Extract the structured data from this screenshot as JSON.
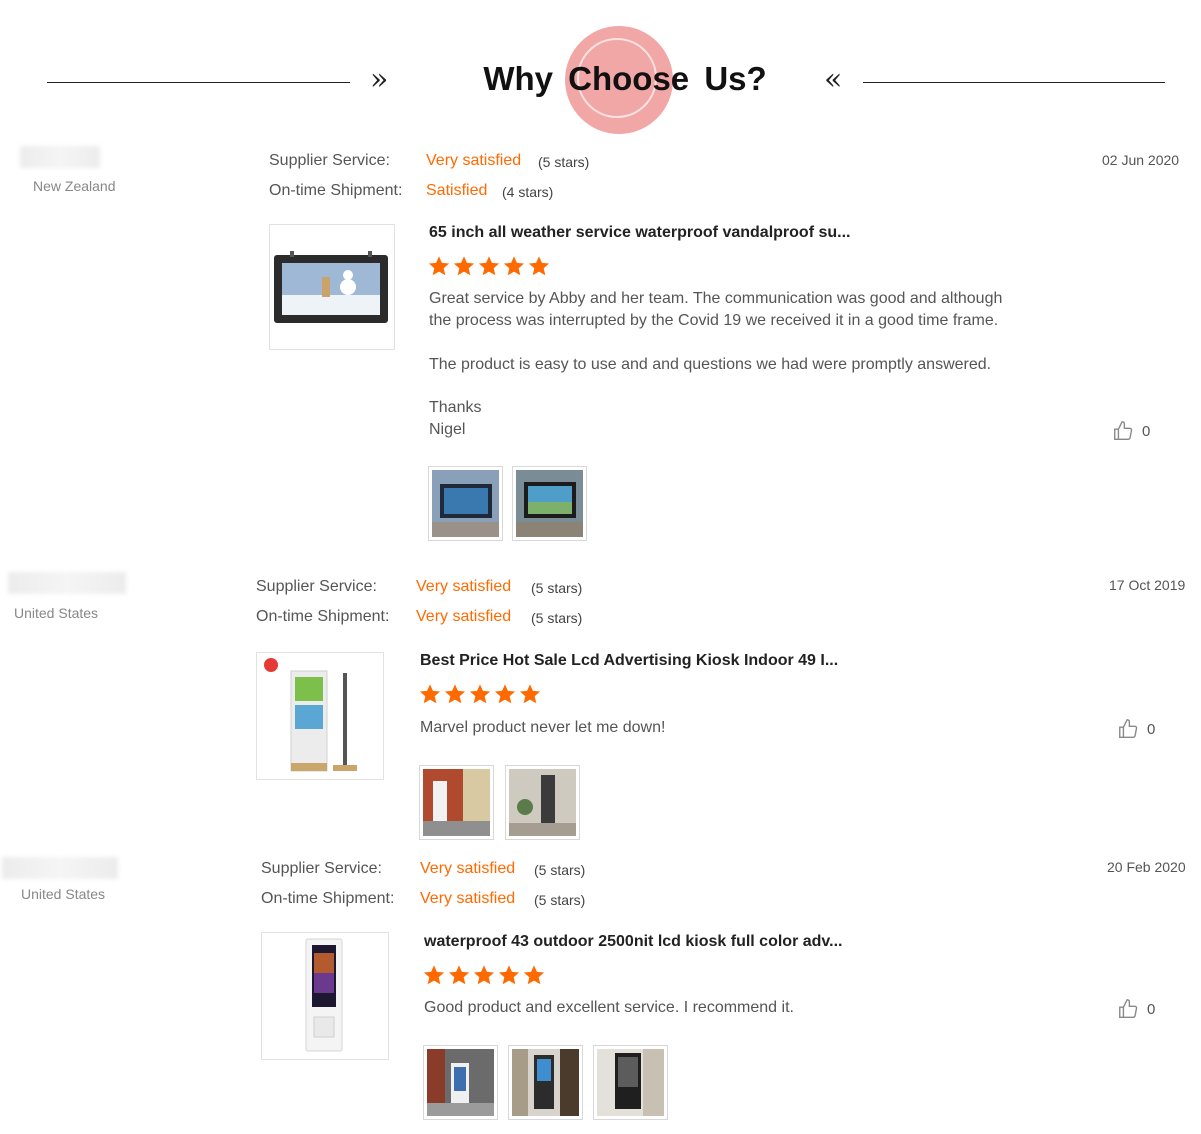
{
  "header": {
    "title": "Why Choose Us?",
    "left_chevron": "»",
    "right_chevron": "«"
  },
  "colors": {
    "accent": "#ff6a00",
    "star": "#ff6a00",
    "logo": "#f2a7a7"
  },
  "reviews": [
    {
      "country": "New Zealand",
      "date": "02 Jun 2020",
      "supplier_label": "Supplier Service:",
      "supplier_value": "Very satisfied",
      "supplier_stars": "(5 stars)",
      "shipment_label": "On-time Shipment:",
      "shipment_value": "Satisfied",
      "shipment_stars": "(4 stars)",
      "product_title": "65 inch all weather service waterproof vandalproof su...",
      "rating": 5,
      "text_lines": [
        "Great service by Abby and her team. The communication was good and although",
        "the process was interrupted by the Covid 19 we received it in a good time frame.",
        "The product is easy to use and and questions we had were promptly answered.",
        "Thanks",
        "Nigel"
      ],
      "likes": "0"
    },
    {
      "country": "United States",
      "date": "17 Oct 2019",
      "supplier_label": "Supplier Service:",
      "supplier_value": "Very satisfied",
      "supplier_stars": "(5 stars)",
      "shipment_label": "On-time Shipment:",
      "shipment_value": "Very satisfied",
      "shipment_stars": "(5 stars)",
      "product_title": "Best Price Hot Sale Lcd Advertising Kiosk Indoor 49 I...",
      "rating": 5,
      "text": "Marvel product never let me down!",
      "likes": "0"
    },
    {
      "country": "United States",
      "date": "20 Feb 2020",
      "supplier_label": "Supplier Service:",
      "supplier_value": "Very satisfied",
      "supplier_stars": "(5 stars)",
      "shipment_label": "On-time Shipment:",
      "shipment_value": "Very satisfied",
      "shipment_stars": "(5 stars)",
      "product_title": "waterproof 43 outdoor 2500nit lcd kiosk full color adv...",
      "rating": 5,
      "text": "Good product and excellent service. I recommend it.",
      "likes": "0"
    }
  ]
}
